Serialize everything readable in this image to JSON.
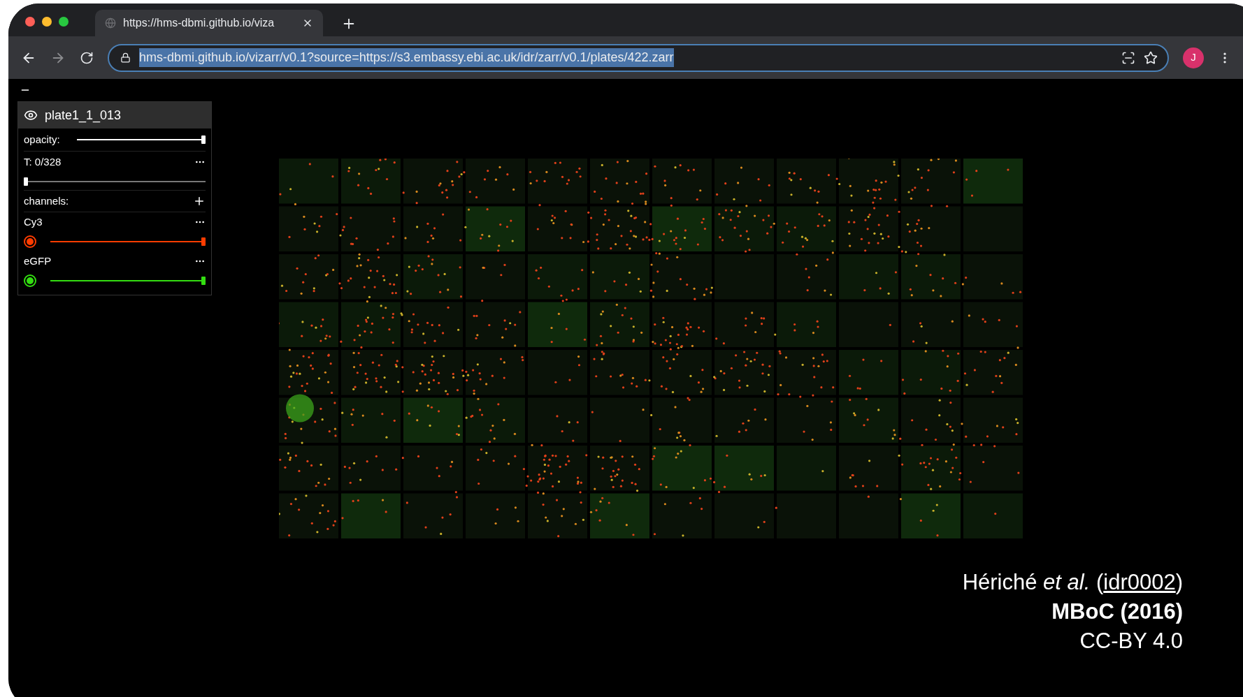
{
  "browser": {
    "tab_title": "https://hms-dbmi.github.io/viza",
    "address": "hms-dbmi.github.io/vizarr/v0.1?source=https://s3.embassy.ebi.ac.uk/idr/zarr/v0.1/plates/422.zarr",
    "address_selected": true,
    "profile_initial": "J"
  },
  "panel": {
    "layer": {
      "name": "plate1_1_013",
      "visible": true
    },
    "opacity": {
      "label": "opacity:",
      "level": 1
    },
    "time": {
      "label": "T: 0/328",
      "level": 0
    },
    "channels_label": "channels:",
    "channels": [
      {
        "name": "Cy3",
        "color": "#ff3c00",
        "on": true,
        "level": 1
      },
      {
        "name": "eGFP",
        "color": "#33dd11",
        "on": true,
        "level": 1
      }
    ]
  },
  "caption": {
    "citation_before": "Hériché *et al.* (",
    "link": "idr0002",
    "citation_after": ")",
    "journal": "MBoC (2016)",
    "license": "CC-BY 4.0"
  }
}
